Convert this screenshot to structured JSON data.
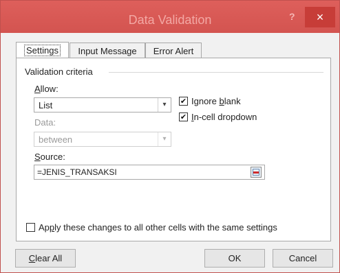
{
  "window": {
    "title": "Data Validation",
    "help_label": "?",
    "close_label": "×"
  },
  "tabs": [
    {
      "label": "Settings",
      "active": true
    },
    {
      "label": "Input Message",
      "active": false
    },
    {
      "label": "Error Alert",
      "active": false
    }
  ],
  "settings": {
    "section_label": "Validation criteria",
    "allow": {
      "label_pre": "",
      "label_key": "A",
      "label_post": "llow:",
      "value": "List"
    },
    "data": {
      "label": "Data:",
      "value": "between"
    },
    "ignore_blank": {
      "label_pre": "Ignore ",
      "label_key": "b",
      "label_post": "lank",
      "checked": true,
      "check_mark": "✔"
    },
    "in_cell_dropdown": {
      "label_pre": "",
      "label_key": "I",
      "label_post": "n-cell dropdown",
      "checked": true,
      "check_mark": "✔"
    },
    "source": {
      "label_pre": "",
      "label_key": "S",
      "label_post": "ource:",
      "value": "=JENIS_TRANSAKSI"
    },
    "apply_all": {
      "label_pre": "Ap",
      "label_key": "p",
      "label_post": "ly these changes to all other cells with the same settings",
      "checked": false
    }
  },
  "buttons": {
    "clear_all": {
      "key": "C",
      "rest": "lear All"
    },
    "ok": "OK",
    "cancel": "Cancel"
  },
  "icons": {
    "dropdown_arrow": "⌄",
    "dropdown_arrow_glyph": "▾"
  },
  "colors": {
    "title_bar": "#d9534f",
    "close_button": "#c73d38"
  }
}
